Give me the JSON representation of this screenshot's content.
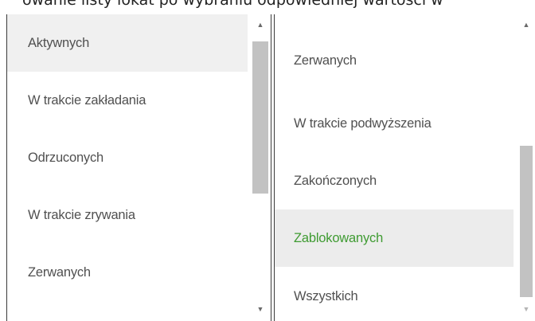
{
  "caption": "owanie listy lokat po wybraniu odpowiedniej wartości w",
  "left_dropdown": {
    "items": [
      {
        "label": "Aktywnych"
      },
      {
        "label": "W trakcie zakładania"
      },
      {
        "label": "Odrzuconych"
      },
      {
        "label": "W trakcie zrywania"
      },
      {
        "label": "Zerwanych"
      }
    ],
    "selected": "Aktywnych"
  },
  "right_dropdown": {
    "items": [
      {
        "label": "Zerwanych"
      },
      {
        "label": "W trakcie podwyższenia"
      },
      {
        "label": "Zakończonych"
      },
      {
        "label": "Zablokowanych"
      },
      {
        "label": "Wszystkich"
      }
    ],
    "highlighted": "Zablokowanych"
  },
  "icons": {
    "scroll_up": "▲",
    "scroll_down": "▼"
  },
  "colors": {
    "highlight_text": "#3f9b32",
    "selected_background": "#f0f0f0",
    "text": "#505050",
    "scroll_thumb": "#c2c2c2"
  }
}
